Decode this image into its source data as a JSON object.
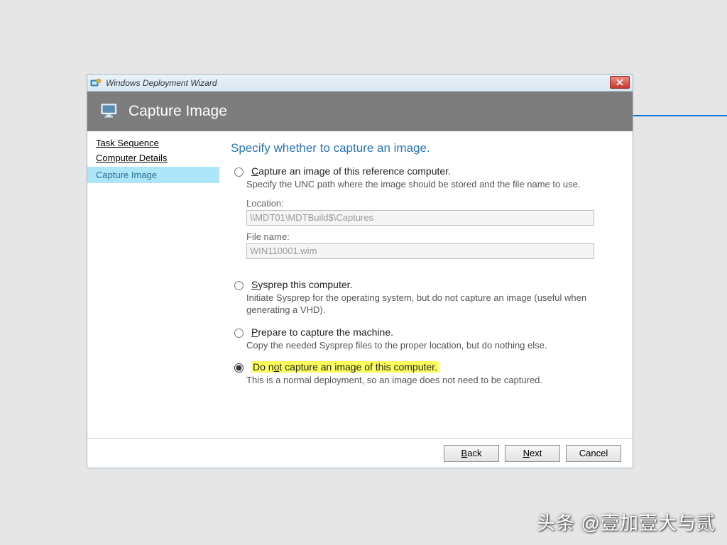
{
  "window": {
    "title": "Windows Deployment Wizard"
  },
  "banner": {
    "title": "Capture Image"
  },
  "sidebar": {
    "items": [
      {
        "label": "Task Sequence",
        "current": false
      },
      {
        "label": "Computer Details",
        "current": false
      },
      {
        "label": "Capture Image",
        "current": true
      }
    ]
  },
  "content": {
    "heading": "Specify whether to capture an image.",
    "options": [
      {
        "id": "capture",
        "label_pre": "",
        "label_ul": "C",
        "label_post": "apture an image of this reference computer.",
        "desc": "Specify the UNC path where the image should be stored and the file name to use.",
        "selected": false,
        "fields": {
          "location_label": "Location:",
          "location_value": "\\\\MDT01\\MDTBuild$\\Captures",
          "filename_label": "File name:",
          "filename_value": "WIN110001.wim"
        }
      },
      {
        "id": "sysprep",
        "label_pre": "",
        "label_ul": "S",
        "label_post": "ysprep this computer.",
        "desc": "Initiate Sysprep for the operating system, but do not capture an image (useful when generating a VHD).",
        "selected": false
      },
      {
        "id": "prepare",
        "label_pre": "",
        "label_ul": "P",
        "label_post": "repare to capture the machine.",
        "desc": "Copy the needed Sysprep files to the proper location, but do nothing else.",
        "selected": false
      },
      {
        "id": "donot",
        "label_pre": "Do n",
        "label_ul": "o",
        "label_post": "t capture an image of this computer.",
        "desc": "This is a normal deployment, so an image does not need to be captured.",
        "selected": true,
        "highlight": true
      }
    ]
  },
  "footer": {
    "back": "ack",
    "back_ul": "B",
    "next": "ext",
    "next_ul": "N",
    "cancel": "Cancel"
  },
  "watermark": "头条 @壹加壹大与贰"
}
